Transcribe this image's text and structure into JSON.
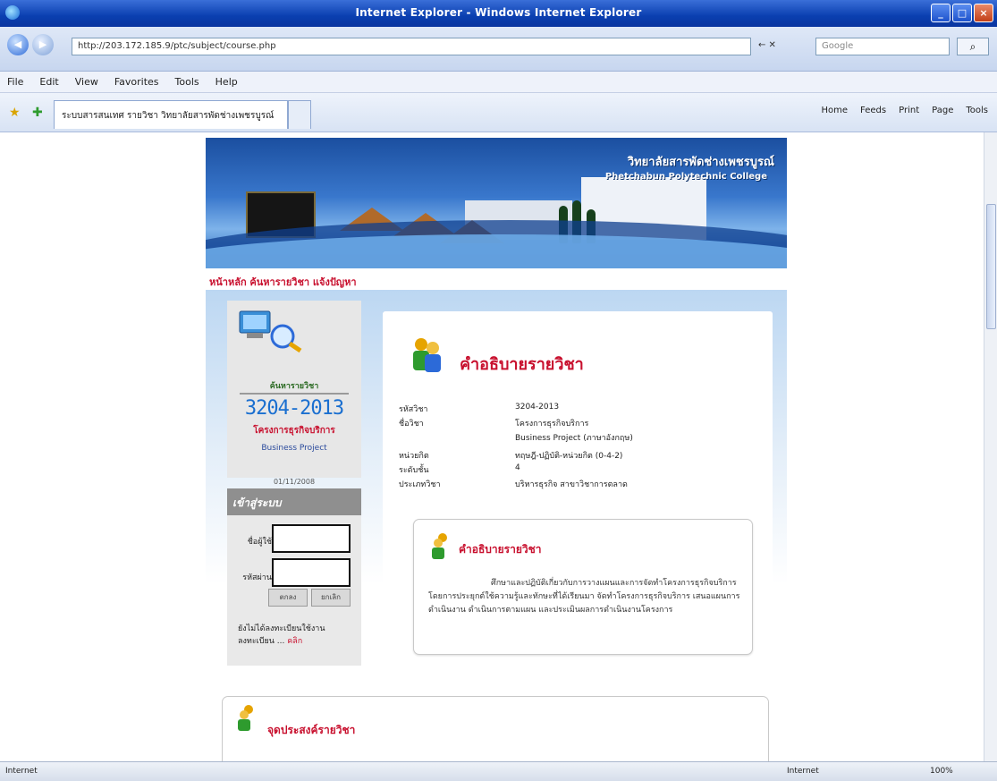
{
  "window": {
    "title": "Internet Explorer - Windows Internet Explorer"
  },
  "addressbar": {
    "url": "http://203.172.185.9/ptc/subject/course.php",
    "go_label": "← ✕",
    "search_placeholder": "Google"
  },
  "menu": {
    "items": [
      "File",
      "Edit",
      "View",
      "Favorites",
      "Tools",
      "Help"
    ]
  },
  "tab": {
    "title": "ระบบสารสนเทศ รายวิชา วิทยาลัยสารพัดช่างเพชรบูรณ์"
  },
  "commandbar": {
    "items": [
      "Home",
      "Feeds",
      "Print",
      "Page",
      "Tools"
    ]
  },
  "banner": {
    "title_th": "วิทยาลัยสารพัดช่างเพชรบูรณ์",
    "title_en": "Phetchabun Polytechnic College"
  },
  "breadcrumb": "หน้าหลัก ค้นหารายวิชา แจ้งปัญหา",
  "promo": {
    "small_code": "ค้นหารายวิชา",
    "code": "3204-2013",
    "name": "โครงการธุรกิจบริการ",
    "name_en": "Business Project",
    "date": "01/11/2008"
  },
  "login": {
    "header": "เข้าสู่ระบบ",
    "user_label": "ชื่อผู้ใช้",
    "pass_label": "รหัสผ่าน",
    "submit_label": "ตกลง",
    "reset_label": "ยกเลิก",
    "note": "ยังไม่ได้ลงทะเบียนใช้งาน",
    "note2": "ลงทะเบียน ...",
    "register_link": "คลิก"
  },
  "course": {
    "title": "คำอธิบายรายวิชา",
    "info": [
      {
        "label": "รหัสวิชา",
        "value": "3204-2013"
      },
      {
        "label": "ชื่อวิชา",
        "value": "โครงการธุรกิจบริการ"
      },
      {
        "label": "",
        "value": "Business Project (ภาษาอังกฤษ)"
      },
      {
        "label": "หน่วยกิต",
        "value": "ทฤษฎี-ปฏิบัติ-หน่วยกิต (0-4-2)"
      },
      {
        "label": "ระดับชั้น",
        "value": "4"
      },
      {
        "label": "ประเภทวิชา",
        "value": "บริหารธุรกิจ สาขาวิชาการตลาด"
      }
    ]
  },
  "description": {
    "title": "คำอธิบายรายวิชา",
    "text": "ศึกษาและปฏิบัติเกี่ยวกับการวางแผนและการจัดทำโครงการธุรกิจบริการ โดยการประยุกต์ใช้ความรู้และทักษะที่ได้เรียนมา จัดทำโครงการธุรกิจบริการ เสนอแผนการดำเนินงาน ดำเนินการตามแผน และประเมินผลการดำเนินงานโครงการ"
  },
  "objectives": {
    "title": "จุดประสงค์รายวิชา"
  },
  "statusbar": {
    "left": "Internet",
    "zone": "Internet",
    "zoom": "100%"
  }
}
